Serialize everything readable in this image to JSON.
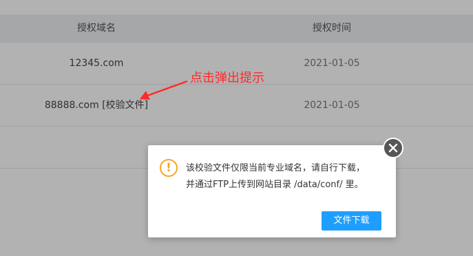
{
  "table": {
    "headers": [
      "授权域名",
      "授权时间"
    ],
    "rows": [
      {
        "domain": "12345.com",
        "verify_link": "",
        "date": "2021-01-05"
      },
      {
        "domain": "88888.com",
        "verify_link": "[校验文件]",
        "date": "2021-01-05"
      }
    ]
  },
  "annotation": {
    "text": "点击弹出提示",
    "color": "#ff2a2a"
  },
  "dialog": {
    "icon": "warning-icon",
    "message_line1": "该校验文件仅限当前专业域名，请自行下载，",
    "message_line2": "并通过FTP上传到网站目录 /data/conf/ 里。",
    "button_label": "文件下载",
    "close_icon": "close-icon",
    "accent_color": "#1e9fff",
    "warning_color": "#f5a623"
  }
}
